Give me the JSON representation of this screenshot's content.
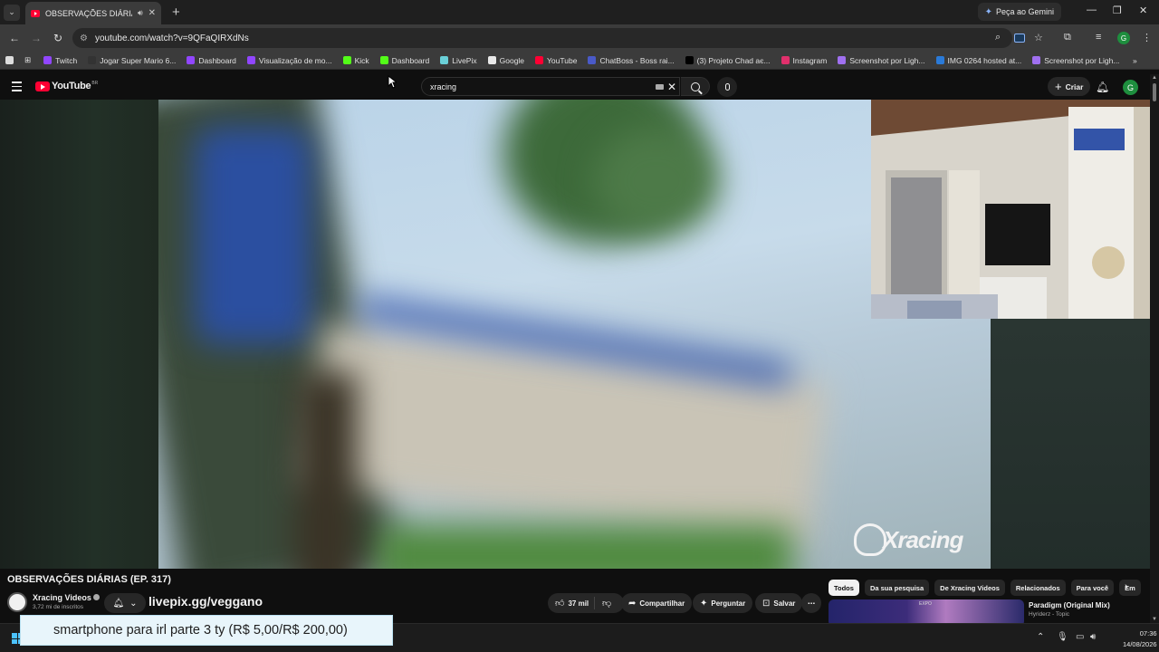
{
  "browser": {
    "tab_title": "OBSERVAÇÕES DIÁRIAS (EP",
    "gemini_label": "Peça ao Gemini",
    "url": "youtube.com/watch?v=9QFaQIRXdNs",
    "profile_initial": "G"
  },
  "bookmarks": [
    {
      "label": "Twitch",
      "color": "#9146ff",
      "icon": "twitch-icon"
    },
    {
      "label": "Jogar Super Mario 6...",
      "color": "#333333",
      "icon": "mario-icon"
    },
    {
      "label": "Dashboard",
      "color": "#9146ff",
      "icon": "twitch-icon"
    },
    {
      "label": "Visualização de mo...",
      "color": "#9146ff",
      "icon": "twitch-icon"
    },
    {
      "label": "Kick",
      "color": "#53fc18",
      "icon": "kick-icon"
    },
    {
      "label": "Dashboard",
      "color": "#53fc18",
      "icon": "kick-icon"
    },
    {
      "label": "LivePix",
      "color": "#6ad0d8",
      "icon": "livepix-icon"
    },
    {
      "label": "Google",
      "color": "#e8e8e8",
      "icon": "google-icon"
    },
    {
      "label": "YouTube",
      "color": "#ff0033",
      "icon": "youtube-icon"
    },
    {
      "label": "ChatBoss - Boss rai...",
      "color": "#4a5ac8",
      "icon": "chatboss-icon"
    },
    {
      "label": "(3) Projeto Chad ає...",
      "color": "#000000",
      "icon": "x-icon"
    },
    {
      "label": "Instagram",
      "color": "#e1306c",
      "icon": "instagram-icon"
    },
    {
      "label": "Screenshot por Ligh...",
      "color": "#a070f0",
      "icon": "lightshot-icon"
    },
    {
      "label": "IMG 0264 hosted at...",
      "color": "#2a7ad8",
      "icon": "imgbb-icon"
    },
    {
      "label": "Screenshot por Ligh...",
      "color": "#a070f0",
      "icon": "lightshot-icon"
    }
  ],
  "youtube": {
    "logo_text": "YouTube",
    "country_code": "BR",
    "search_query": "xracing",
    "create_label": "Criar",
    "avatar_initial": "G"
  },
  "video": {
    "watermark": "Xracing",
    "title": "OBSERVAÇÕES DIÁRIAS (EP. 317)",
    "channel_name": "Xracing Videos",
    "subscribers": "3,72 mi de inscritos",
    "promo_text": "livepix.gg/veggano",
    "likes": "37 mil",
    "share_label": "Compartilhar",
    "ask_label": "Perguntar",
    "save_label": "Salvar"
  },
  "chips": [
    "Todos",
    "Da sua pesquisa",
    "De Xracing Videos",
    "Relacionados",
    "Para você",
    "Em"
  ],
  "recommendation": {
    "title": "Paradigm (Original Mix)",
    "subtitle": "Hyriderz - Topic",
    "thumb_label": "EXPO"
  },
  "taskbar": {
    "time": "07:36",
    "date": "14/08/2026"
  },
  "alert": {
    "text": "smartphone para irl parte 3 ty (R$ 5,00/R$ 200,00)"
  }
}
